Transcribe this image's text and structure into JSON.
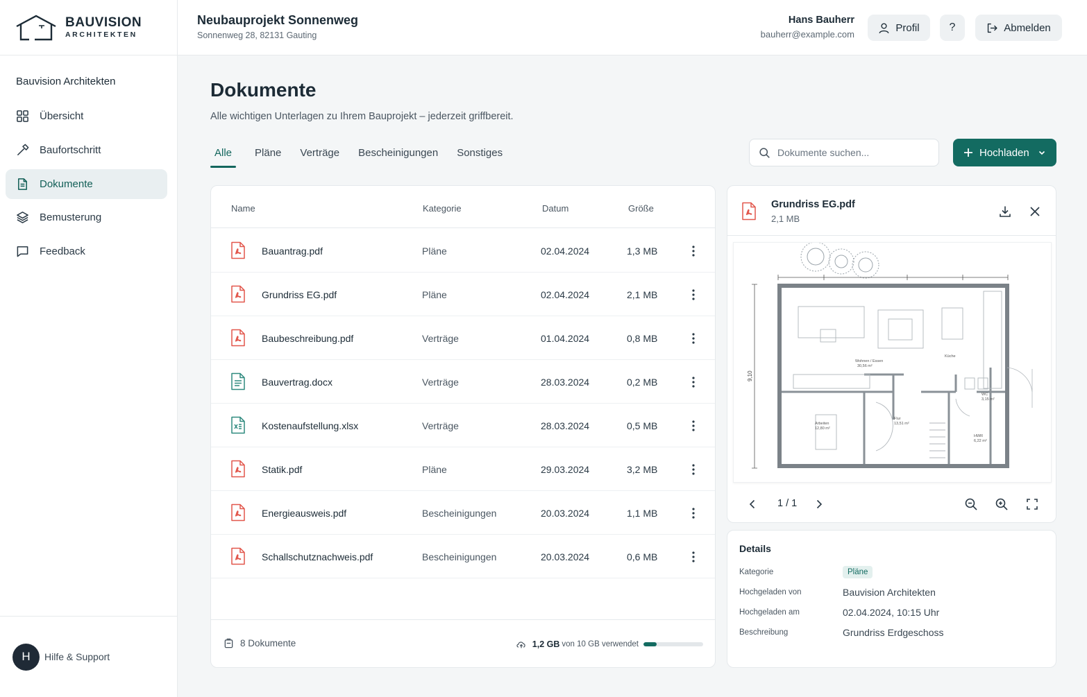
{
  "brand": {
    "name": "BAUVISION",
    "sub": "ARCHITEKTEN"
  },
  "sidebar": {
    "org_name": "Bauvision Architekten",
    "items": [
      {
        "label": "Übersicht",
        "icon": "grid-icon",
        "active": false
      },
      {
        "label": "Baufortschritt",
        "icon": "hammer-icon",
        "active": false
      },
      {
        "label": "Dokumente",
        "icon": "document-icon",
        "active": true
      },
      {
        "label": "Bemusterung",
        "icon": "layers-icon",
        "active": false
      },
      {
        "label": "Feedback",
        "icon": "chat-icon",
        "active": false
      }
    ],
    "footer": {
      "avatar_initial": "H",
      "support_label": "Hilfe & Support"
    }
  },
  "header": {
    "project_title": "Neubauprojekt Sonnenweg",
    "project_address": "Sonnenweg 28, 82131 Gauting",
    "user_name": "Hans Bauherr",
    "user_email": "bauherr@example.com",
    "profile_label": "Profil",
    "help_label": "?",
    "logout_label": "Abmelden"
  },
  "main": {
    "title": "Dokumente",
    "subtitle": "Alle wichtigen Unterlagen zu Ihrem Bauprojekt – jederzeit griffbereit.",
    "tabs": [
      {
        "label": "Alle",
        "active": true
      },
      {
        "label": "Pläne",
        "active": false
      },
      {
        "label": "Verträge",
        "active": false
      },
      {
        "label": "Bescheinigungen",
        "active": false
      },
      {
        "label": "Sonstiges",
        "active": false
      }
    ],
    "search_placeholder": "Dokumente suchen...",
    "upload_label": "Hochladen"
  },
  "table": {
    "columns": {
      "name": "Name",
      "category": "Kategorie",
      "date": "Datum",
      "size": "Größe"
    },
    "rows": [
      {
        "name": "Bauantrag.pdf",
        "category": "Pläne",
        "date": "02.04.2024",
        "size": "1,3 MB",
        "type": "pdf"
      },
      {
        "name": "Grundriss EG.pdf",
        "category": "Pläne",
        "date": "02.04.2024",
        "size": "2,1 MB",
        "type": "pdf"
      },
      {
        "name": "Baubeschreibung.pdf",
        "category": "Verträge",
        "date": "01.04.2024",
        "size": "0,8 MB",
        "type": "pdf"
      },
      {
        "name": "Bauvertrag.docx",
        "category": "Verträge",
        "date": "28.03.2024",
        "size": "0,2 MB",
        "type": "docx"
      },
      {
        "name": "Kostenaufstellung.xlsx",
        "category": "Verträge",
        "date": "28.03.2024",
        "size": "0,5 MB",
        "type": "xlsx"
      },
      {
        "name": "Statik.pdf",
        "category": "Pläne",
        "date": "29.03.2024",
        "size": "3,2 MB",
        "type": "pdf"
      },
      {
        "name": "Energieausweis.pdf",
        "category": "Bescheinigungen",
        "date": "20.03.2024",
        "size": "1,1 MB",
        "type": "pdf"
      },
      {
        "name": "Schallschutznachweis.pdf",
        "category": "Bescheinigungen",
        "date": "20.03.2024",
        "size": "0,6 MB",
        "type": "pdf"
      }
    ],
    "footer": {
      "count_label": "8 Dokumente",
      "storage_used": "1,2 GB",
      "storage_total": "von 10 GB verwendet",
      "storage_fraction": 0.12
    }
  },
  "preview": {
    "file_name": "Grundriss EG.pdf",
    "file_size": "2,1 MB",
    "page_indicator": "1 / 1",
    "plan_labels": {
      "dimension": "9,10",
      "living": "Wohnen / Essen",
      "living_area": "30,56 m²",
      "kitchen": "Küche",
      "wc": "WC",
      "wc_area": "3,15 m²",
      "office": "Arbeiten",
      "office_area": "12,80 m²",
      "hall": "Flur",
      "hall_area": "13,51 m²",
      "storage": "HWR",
      "storage_area": "6,22 m²"
    }
  },
  "details": {
    "title": "Details",
    "rows": [
      {
        "label": "Kategorie",
        "value": "Pläne",
        "badge": true
      },
      {
        "label": "Hochgeladen von",
        "value": "Bauvision Architekten",
        "badge": false
      },
      {
        "label": "Hochgeladen am",
        "value": "02.04.2024, 10:15 Uhr",
        "badge": false
      },
      {
        "label": "Beschreibung",
        "value": "Grundriss Erdgeschoss",
        "badge": false
      }
    ]
  },
  "colors": {
    "accent": "#136b61",
    "pdf": "#e2574c",
    "docx": "#2f8a7f",
    "xlsx": "#2f8a7f",
    "nav_active_bg": "#e9eff1"
  }
}
